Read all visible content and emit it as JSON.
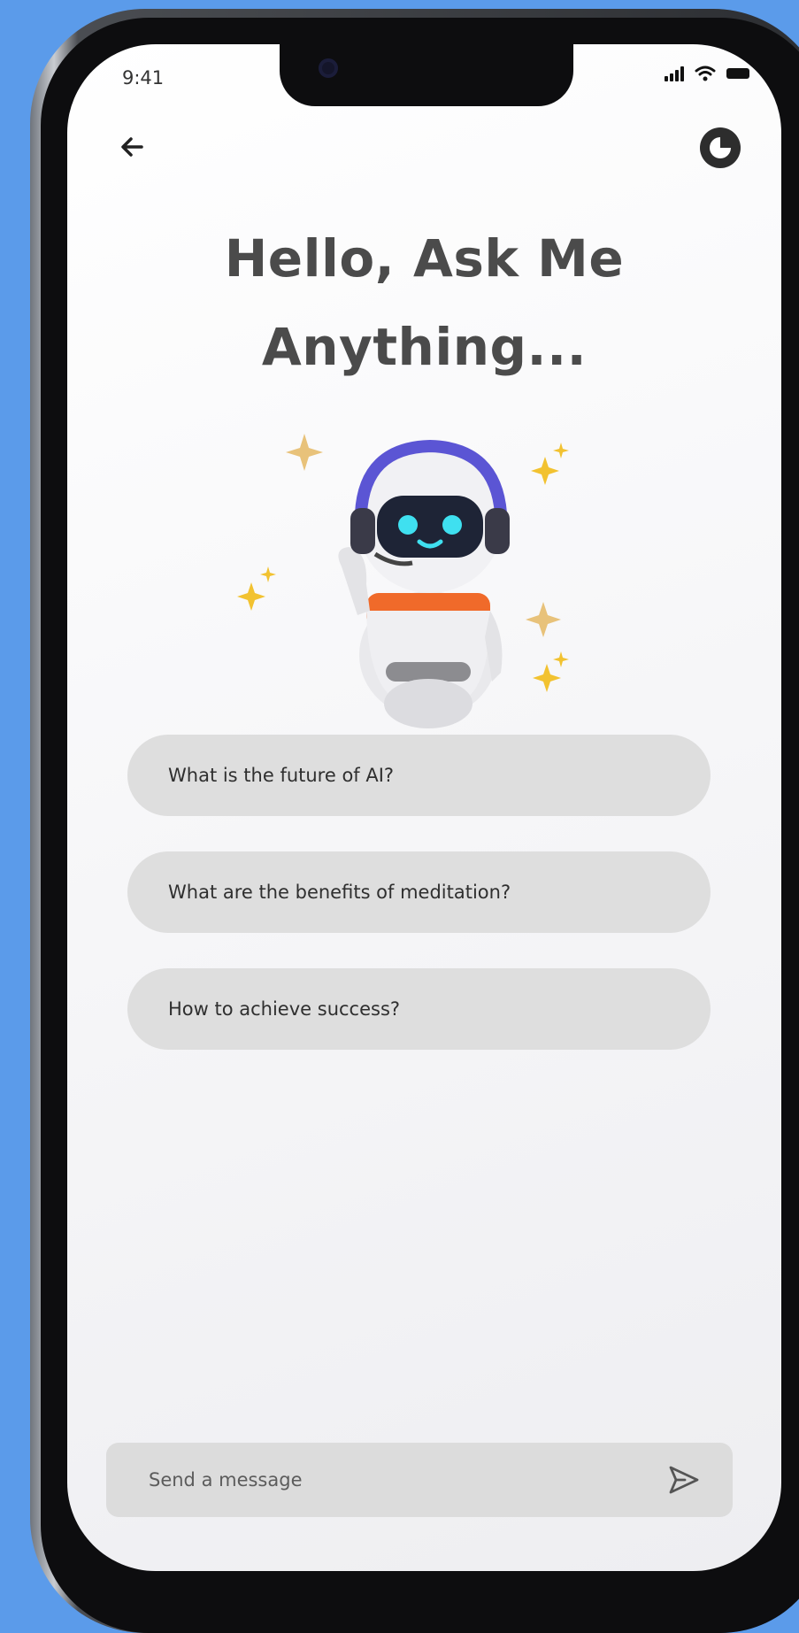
{
  "status_bar": {
    "time": "9:41"
  },
  "header": {
    "back_icon": "arrow-left-icon",
    "theme_icon": "theme-toggle-icon"
  },
  "title": {
    "line1": "Hello, Ask Me",
    "line2": "Anything..."
  },
  "hero": {
    "icon": "robot-mascot-icon"
  },
  "suggestions": [
    {
      "label": "What is the future of AI?"
    },
    {
      "label": "What are the benefits of meditation?"
    },
    {
      "label": "How to achieve success?"
    }
  ],
  "composer": {
    "placeholder": "Send a message",
    "value": "",
    "send_icon": "send-icon"
  },
  "colors": {
    "background": "#5b9bea",
    "chip": "#dedede",
    "title": "#4b4b4b",
    "robot_eyes": "#3fe0f0",
    "robot_headphones": "#5b55d4",
    "robot_accent": "#f06a2a",
    "sparkle": "#f2c230"
  }
}
